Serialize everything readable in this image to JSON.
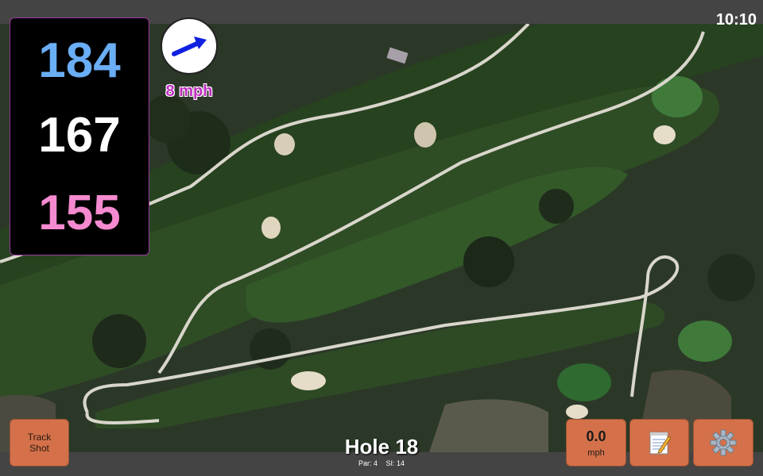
{
  "status": {
    "time": "10:10"
  },
  "distances": {
    "back": "184",
    "middle": "167",
    "front": "155"
  },
  "wind": {
    "speed_label": "8 mph",
    "arrow_icon": "arrow-right-up-icon"
  },
  "hole": {
    "title": "Hole 18",
    "par_label": "Par: 4",
    "si_label": "SI: 14"
  },
  "buttons": {
    "track_shot_line1": "Track",
    "track_shot_line2": "Shot",
    "speed_value": "0.0",
    "speed_unit": "mph",
    "notes_icon": "notepad-icon",
    "settings_icon": "gear-icon"
  },
  "colors": {
    "back_distance": "#6aaef5",
    "middle_distance": "#ffffff",
    "front_distance": "#f58ad0",
    "wind_speed_text": "#c030c0",
    "wind_arrow": "#1020e0",
    "button_bg": "#d4714a",
    "panel_border": "#9a3aa0"
  }
}
